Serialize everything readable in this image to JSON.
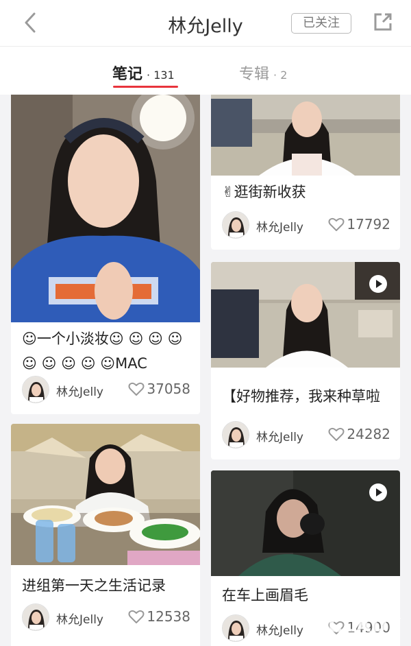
{
  "header": {
    "title": "林允Jelly",
    "follow_label": "已关注"
  },
  "tabs": [
    {
      "label": "笔记",
      "count": "· 131"
    },
    {
      "label": "专辑",
      "count": "· 2"
    }
  ],
  "notes": [
    {
      "caption": "☺一个小淡妆☺ ☺ ☺ ☺ ☺ ☺ ☺ ☺ ☺MAC",
      "author": "林允Jelly",
      "likes": "37058"
    },
    {
      "caption": "进组第一天之生活记录",
      "author": "林允Jelly",
      "likes": "12538"
    },
    {
      "caption": "✌逛街新收获",
      "author": "林允Jelly",
      "likes": "17792"
    },
    {
      "caption": "【好物推荐，我来种草啦",
      "author": "林允Jelly",
      "likes": "24282"
    },
    {
      "caption": "在车上画眉毛",
      "author": "林允Jelly",
      "likes": "14900"
    }
  ],
  "watermark": "PCLADY",
  "colors": {
    "accent": "#e8343c"
  }
}
